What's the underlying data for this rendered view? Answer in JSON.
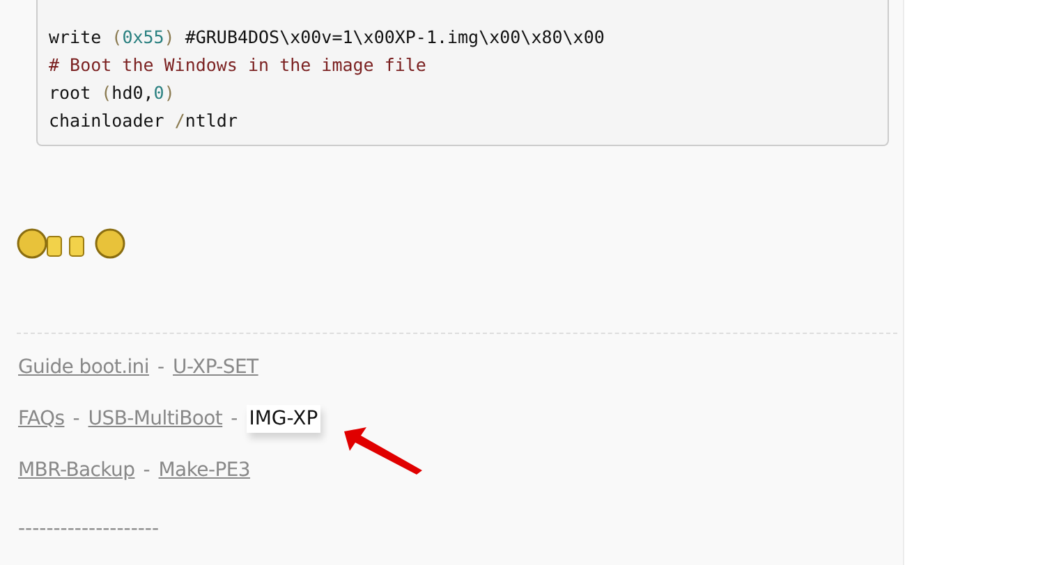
{
  "code": {
    "lines": [
      [
        {
          "kind": "plain",
          "text": "write "
        },
        {
          "kind": "paren",
          "text": "("
        },
        {
          "kind": "number",
          "text": "0x55"
        },
        {
          "kind": "paren",
          "text": ")"
        },
        {
          "kind": "plain",
          "text": " #GRUB4DOS\\x00v=1\\x00XP-1.img\\x00\\x80\\x00"
        }
      ],
      [
        {
          "kind": "comment",
          "text": "# Boot the Windows in the image file"
        }
      ],
      [
        {
          "kind": "plain",
          "text": "root "
        },
        {
          "kind": "paren",
          "text": "("
        },
        {
          "kind": "plain",
          "text": "hd0,"
        },
        {
          "kind": "number",
          "text": "0"
        },
        {
          "kind": "paren",
          "text": ")"
        }
      ],
      [
        {
          "kind": "plain",
          "text": "chainloader "
        },
        {
          "kind": "paren",
          "text": "/"
        },
        {
          "kind": "plain",
          "text": "ntldr"
        }
      ]
    ]
  },
  "link_rows": [
    [
      {
        "kind": "link",
        "text": "Guide boot.ini",
        "current": false
      },
      {
        "kind": "sep",
        "text": "-"
      },
      {
        "kind": "link",
        "text": "U-XP-SET",
        "current": false
      }
    ],
    [
      {
        "kind": "link",
        "text": "FAQs",
        "current": false
      },
      {
        "kind": "sep",
        "text": "-"
      },
      {
        "kind": "link",
        "text": "USB-MultiBoot",
        "current": false
      },
      {
        "kind": "sep",
        "text": "-"
      },
      {
        "kind": "link",
        "text": "IMG-XP",
        "current": true
      }
    ],
    [
      {
        "kind": "link",
        "text": "MBR-Backup",
        "current": false
      },
      {
        "kind": "sep",
        "text": "-"
      },
      {
        "kind": "link",
        "text": "Make-PE3",
        "current": false
      }
    ]
  ],
  "footer_rule": "--------------------"
}
